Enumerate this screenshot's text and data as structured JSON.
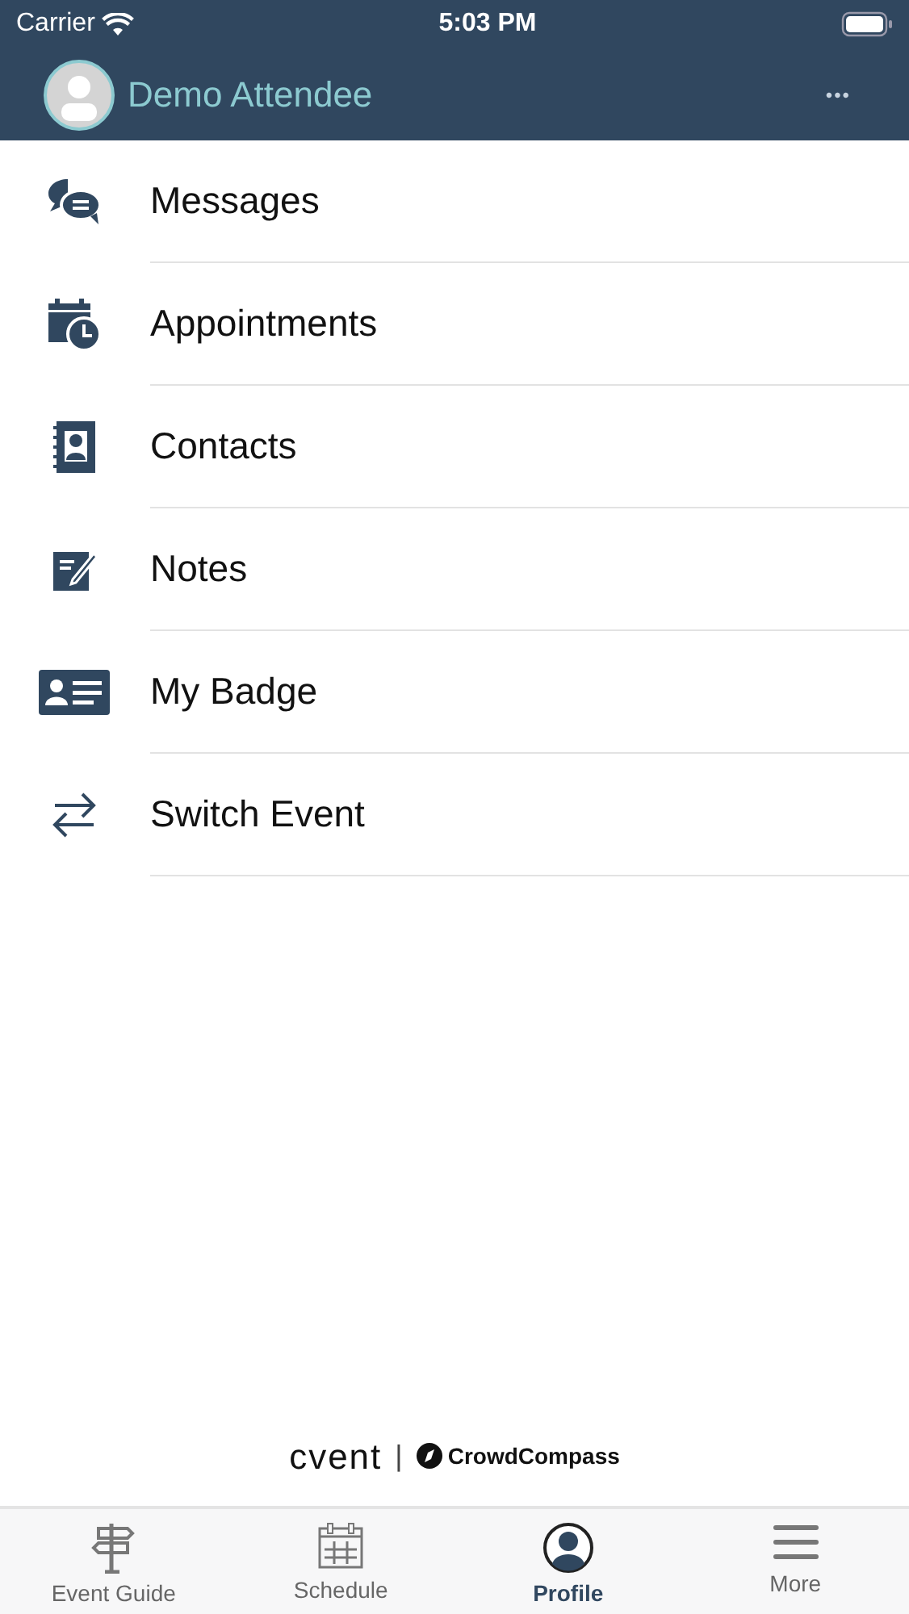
{
  "status_bar": {
    "carrier": "Carrier",
    "time": "5:03 PM"
  },
  "header": {
    "name": "Demo Attendee",
    "more": "•••"
  },
  "menu": [
    {
      "label": "Messages"
    },
    {
      "label": "Appointments"
    },
    {
      "label": "Contacts"
    },
    {
      "label": "Notes"
    },
    {
      "label": "My Badge"
    },
    {
      "label": "Switch Event"
    }
  ],
  "footer": {
    "brand": "cvent",
    "separator": "|",
    "product": "CrowdCompass"
  },
  "tabs": [
    {
      "label": "Event Guide",
      "selected": false
    },
    {
      "label": "Schedule",
      "selected": false
    },
    {
      "label": "Profile",
      "selected": true
    },
    {
      "label": "More",
      "selected": false
    }
  ]
}
